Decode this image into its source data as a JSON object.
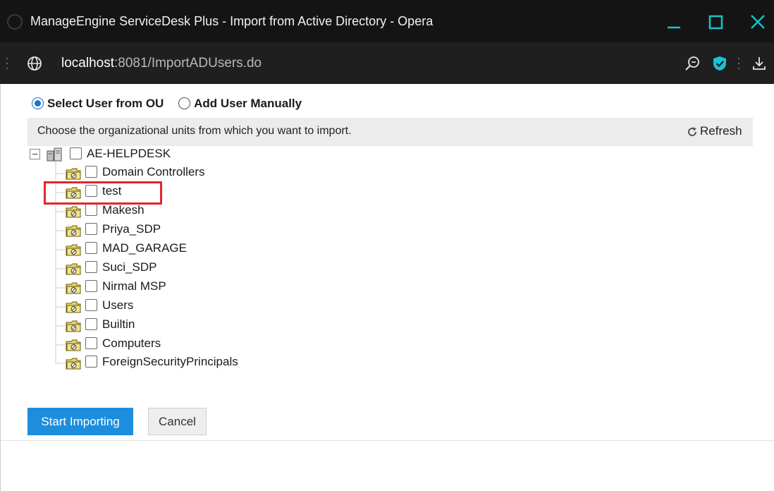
{
  "window": {
    "title": "ManageEngine ServiceDesk Plus - Import from Active Directory - Opera"
  },
  "addressbar": {
    "host": "localhost",
    "path": ":8081/ImportADUsers.do"
  },
  "import_mode": {
    "options": [
      {
        "label": "Select User from OU",
        "selected": true
      },
      {
        "label": "Add User Manually",
        "selected": false
      }
    ]
  },
  "info": {
    "message": "Choose the organizational units from which you want to import.",
    "refresh_label": "Refresh"
  },
  "tree": {
    "root": {
      "label": "AE-HELPDESK",
      "checked": false,
      "expanded": true
    },
    "items": [
      {
        "label": "Domain Controllers",
        "checked": false
      },
      {
        "label": "test",
        "checked": false,
        "highlighted": true
      },
      {
        "label": "Makesh",
        "checked": false
      },
      {
        "label": "Priya_SDP",
        "checked": false
      },
      {
        "label": "MAD_GARAGE",
        "checked": false
      },
      {
        "label": "Suci_SDP",
        "checked": false
      },
      {
        "label": "Nirmal MSP",
        "checked": false
      },
      {
        "label": "Users",
        "checked": false
      },
      {
        "label": "Builtin",
        "checked": false
      },
      {
        "label": "Computers",
        "checked": false
      },
      {
        "label": "ForeignSecurityPrincipals",
        "checked": false
      }
    ]
  },
  "actions": {
    "start_label": "Start Importing",
    "cancel_label": "Cancel"
  },
  "colors": {
    "primary_button": "#1d8ede",
    "highlight": "#e2262c",
    "titlebar": "#141414",
    "window_controls": "#17c3c9"
  }
}
